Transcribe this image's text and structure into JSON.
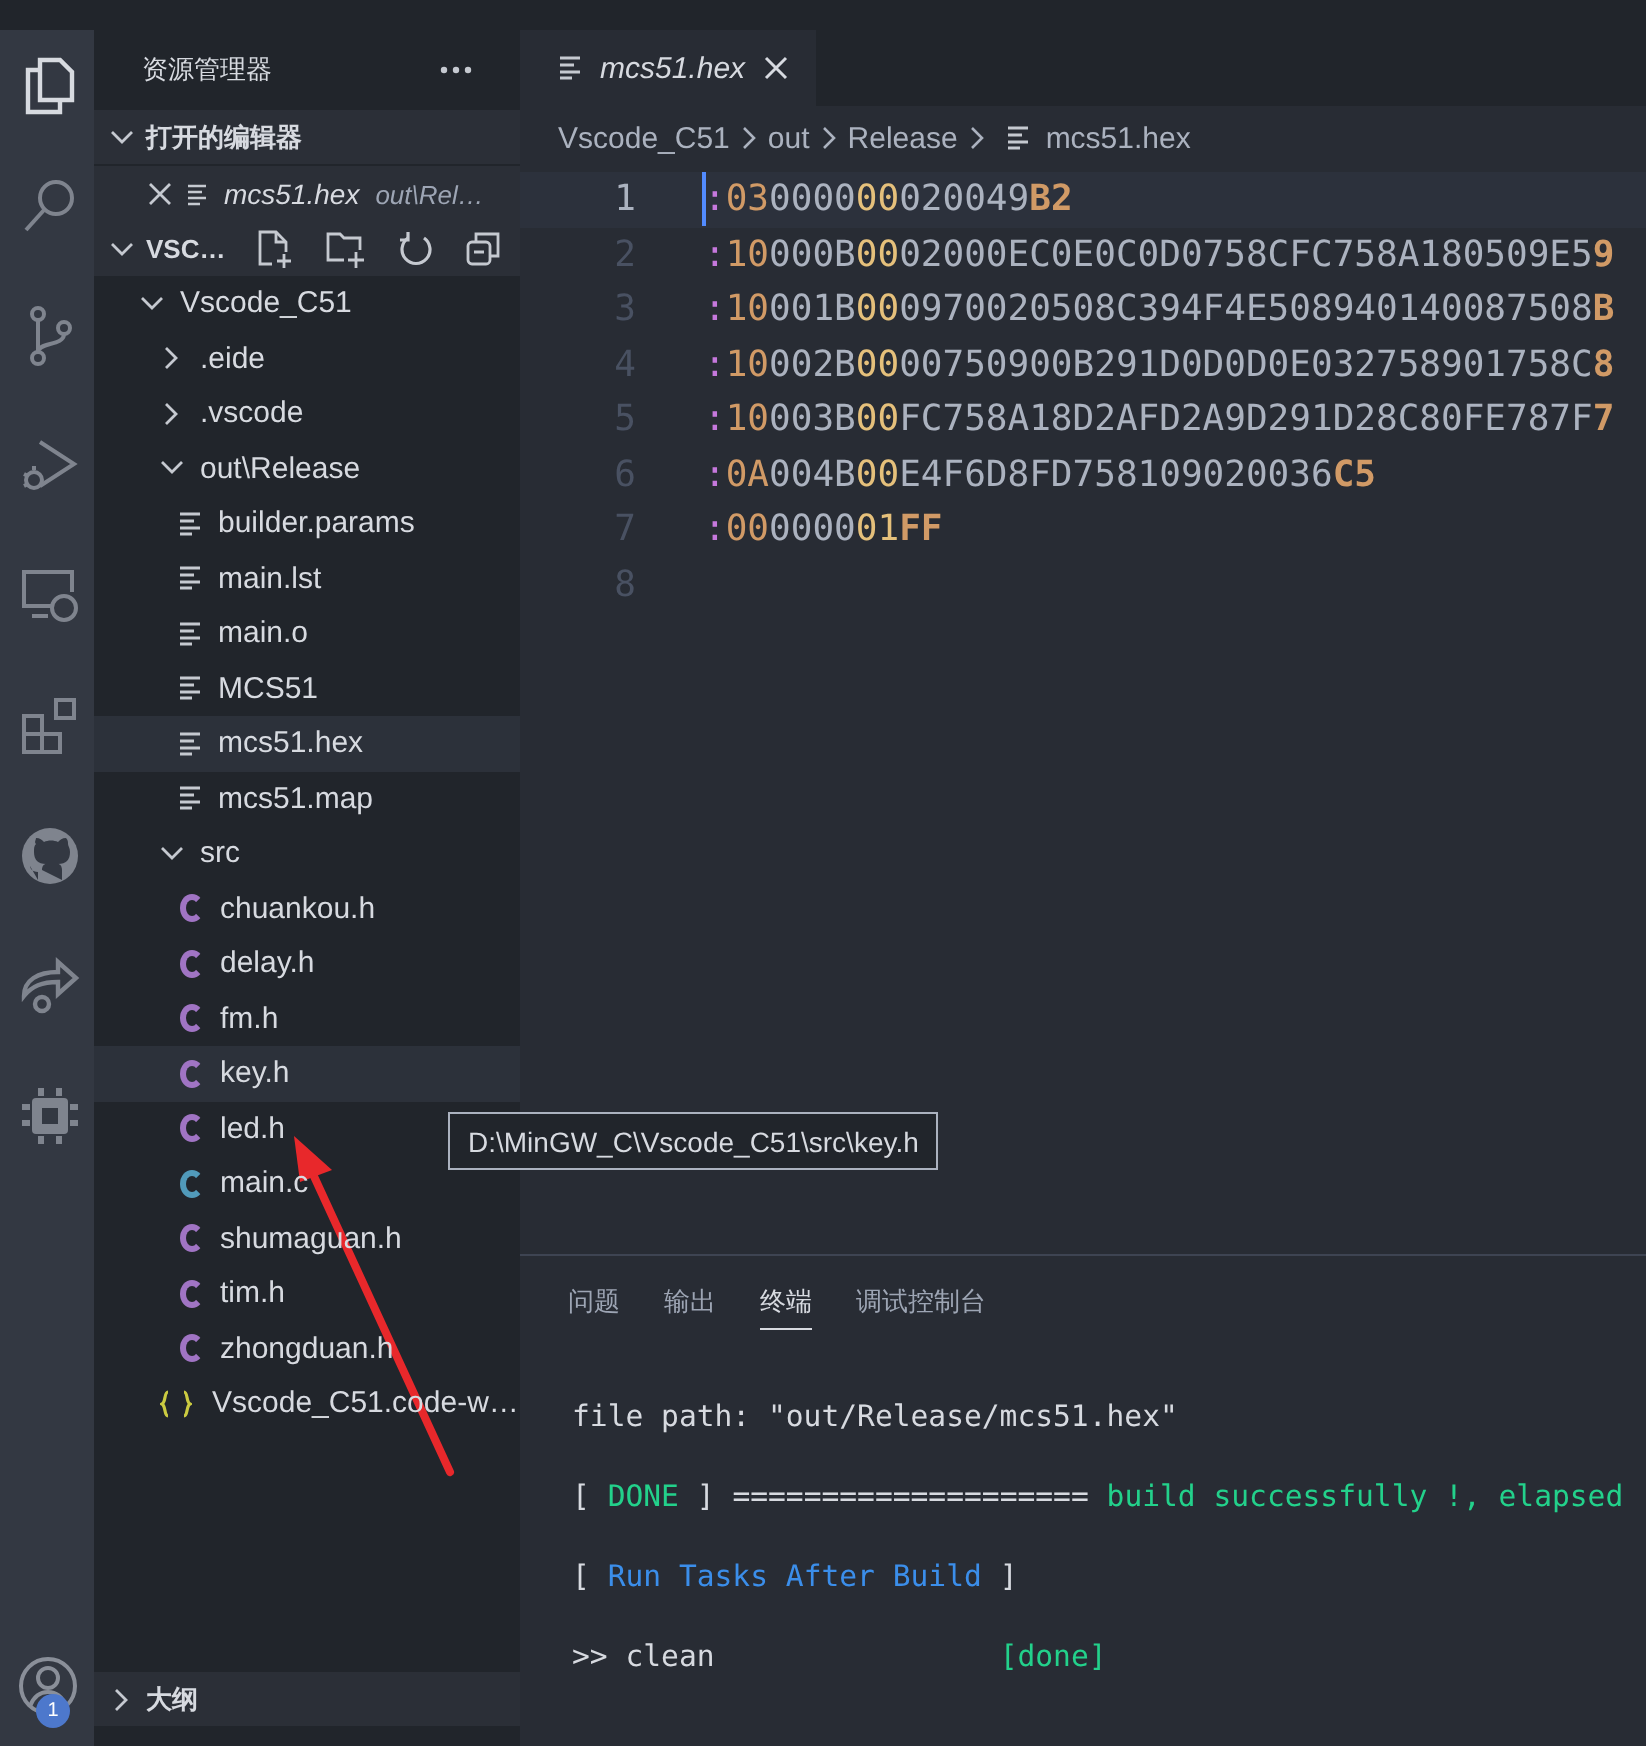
{
  "activity_bar": {
    "items": [
      {
        "kind": "files",
        "selected": true
      },
      {
        "kind": "search",
        "selected": false
      },
      {
        "kind": "source-control",
        "selected": false
      },
      {
        "kind": "run-debug",
        "selected": false
      },
      {
        "kind": "remote",
        "selected": false
      },
      {
        "kind": "extensions",
        "selected": false
      },
      {
        "kind": "github",
        "selected": false
      },
      {
        "kind": "share",
        "selected": false
      },
      {
        "kind": "chip",
        "selected": false
      }
    ],
    "account_badge": "1"
  },
  "sidebar": {
    "title": "资源管理器",
    "open_editors": {
      "title": "打开的编辑器",
      "expanded": true,
      "items": [
        {
          "name": "mcs51.hex",
          "path": "out\\Rel…"
        }
      ]
    },
    "workspace": {
      "title": "VSC…",
      "expanded": true,
      "tree": [
        {
          "name": "Vscode_C51",
          "kind": "folder",
          "expanded": true,
          "children": [
            {
              "name": ".eide",
              "kind": "folder",
              "expanded": false
            },
            {
              "name": ".vscode",
              "kind": "folder",
              "expanded": false
            },
            {
              "name": "out\\Release",
              "kind": "folder",
              "expanded": true,
              "children": [
                {
                  "name": "builder.params",
                  "kind": "text",
                  "selected": false,
                  "hovered": false
                },
                {
                  "name": "main.lst",
                  "kind": "text",
                  "selected": false,
                  "hovered": false
                },
                {
                  "name": "main.o",
                  "kind": "text",
                  "selected": false,
                  "hovered": false
                },
                {
                  "name": "MCS51",
                  "kind": "text",
                  "selected": false,
                  "hovered": false
                },
                {
                  "name": "mcs51.hex",
                  "kind": "text",
                  "selected": true,
                  "hovered": false
                },
                {
                  "name": "mcs51.map",
                  "kind": "text",
                  "selected": false,
                  "hovered": false
                }
              ]
            },
            {
              "name": "src",
              "kind": "folder",
              "expanded": true,
              "children": [
                {
                  "name": "chuankou.h",
                  "kind": "c-header",
                  "selected": false,
                  "hovered": false
                },
                {
                  "name": "delay.h",
                  "kind": "c-header",
                  "selected": false,
                  "hovered": false
                },
                {
                  "name": "fm.h",
                  "kind": "c-header",
                  "selected": false,
                  "hovered": false
                },
                {
                  "name": "key.h",
                  "kind": "c-header",
                  "selected": false,
                  "hovered": true
                },
                {
                  "name": "led.h",
                  "kind": "c-header",
                  "selected": false,
                  "hovered": false
                },
                {
                  "name": "main.c",
                  "kind": "c-source",
                  "selected": false,
                  "hovered": false
                },
                {
                  "name": "shumaguan.h",
                  "kind": "c-header",
                  "selected": false,
                  "hovered": false
                },
                {
                  "name": "tim.h",
                  "kind": "c-header",
                  "selected": false,
                  "hovered": false
                },
                {
                  "name": "zhongduan.h",
                  "kind": "c-header",
                  "selected": false,
                  "hovered": false
                }
              ]
            },
            {
              "name": "Vscode_C51.code-w…",
              "kind": "workspace",
              "selected": false,
              "hovered": false
            }
          ]
        }
      ]
    },
    "outline": {
      "title": "大纲",
      "expanded": false
    }
  },
  "tooltip": "D:\\MinGW_C\\Vscode_C51\\src\\key.h",
  "editor": {
    "tabs": [
      {
        "label": "mcs51.hex",
        "selected": true
      }
    ],
    "breadcrumb": [
      {
        "label": "Vscode_C51",
        "kind": "folder"
      },
      {
        "label": "out",
        "kind": "folder"
      },
      {
        "label": "Release",
        "kind": "folder"
      },
      {
        "label": "mcs51.hex",
        "kind": "file"
      }
    ],
    "lines": [
      {
        "number": "1",
        "current": true,
        "colon": ":",
        "count": "03",
        "address": "0000",
        "type": "00",
        "data": "020049",
        "checksum": "B2"
      },
      {
        "number": "2",
        "current": false,
        "colon": ":",
        "count": "10",
        "address": "000B",
        "type": "00",
        "data": "02000EC0E0C0D0758CFC758A180509E5",
        "checksum": "9"
      },
      {
        "number": "3",
        "current": false,
        "colon": ":",
        "count": "10",
        "address": "001B",
        "type": "00",
        "data": "0970020508C394F4E508940140087508",
        "checksum": "B"
      },
      {
        "number": "4",
        "current": false,
        "colon": ":",
        "count": "10",
        "address": "002B",
        "type": "00",
        "data": "00750900B291D0D0D0E032758901758C",
        "checksum": "8"
      },
      {
        "number": "5",
        "current": false,
        "colon": ":",
        "count": "10",
        "address": "003B",
        "type": "00",
        "data": "FC758A18D2AFD2A9D291D28C80FE787F",
        "checksum": "7"
      },
      {
        "number": "6",
        "current": false,
        "colon": ":",
        "count": "0A",
        "address": "004B",
        "type": "00",
        "data": "E4F6D8FD758109020036",
        "checksum": "C5"
      },
      {
        "number": "7",
        "current": false,
        "colon": ":",
        "count": "00",
        "address": "0000",
        "type": "01",
        "checksum": "FF"
      },
      {
        "number": "8",
        "current": false
      }
    ]
  },
  "panel": {
    "tabs": [
      {
        "label": "问题",
        "selected": false
      },
      {
        "label": "输出",
        "selected": false
      },
      {
        "label": "终端",
        "selected": true
      },
      {
        "label": "调试控制台",
        "selected": false
      }
    ],
    "terminal": [
      [
        {
          "kind": "plain",
          "text": "file path: \"out/Release/mcs51.hex\""
        }
      ],
      [
        {
          "kind": "plain",
          "text": "[ "
        },
        {
          "kind": "success",
          "text": "DONE"
        },
        {
          "kind": "plain",
          "text": " ] ==================== "
        },
        {
          "kind": "success",
          "text": "build successfully !, elapsed"
        }
      ],
      [
        {
          "kind": "plain",
          "text": "[ "
        },
        {
          "kind": "info",
          "text": "Run Tasks After Build"
        },
        {
          "kind": "plain",
          "text": " ]"
        }
      ],
      [
        {
          "kind": "plain",
          "text": ">> clean                "
        },
        {
          "kind": "success",
          "text": "[done]"
        }
      ]
    ]
  }
}
